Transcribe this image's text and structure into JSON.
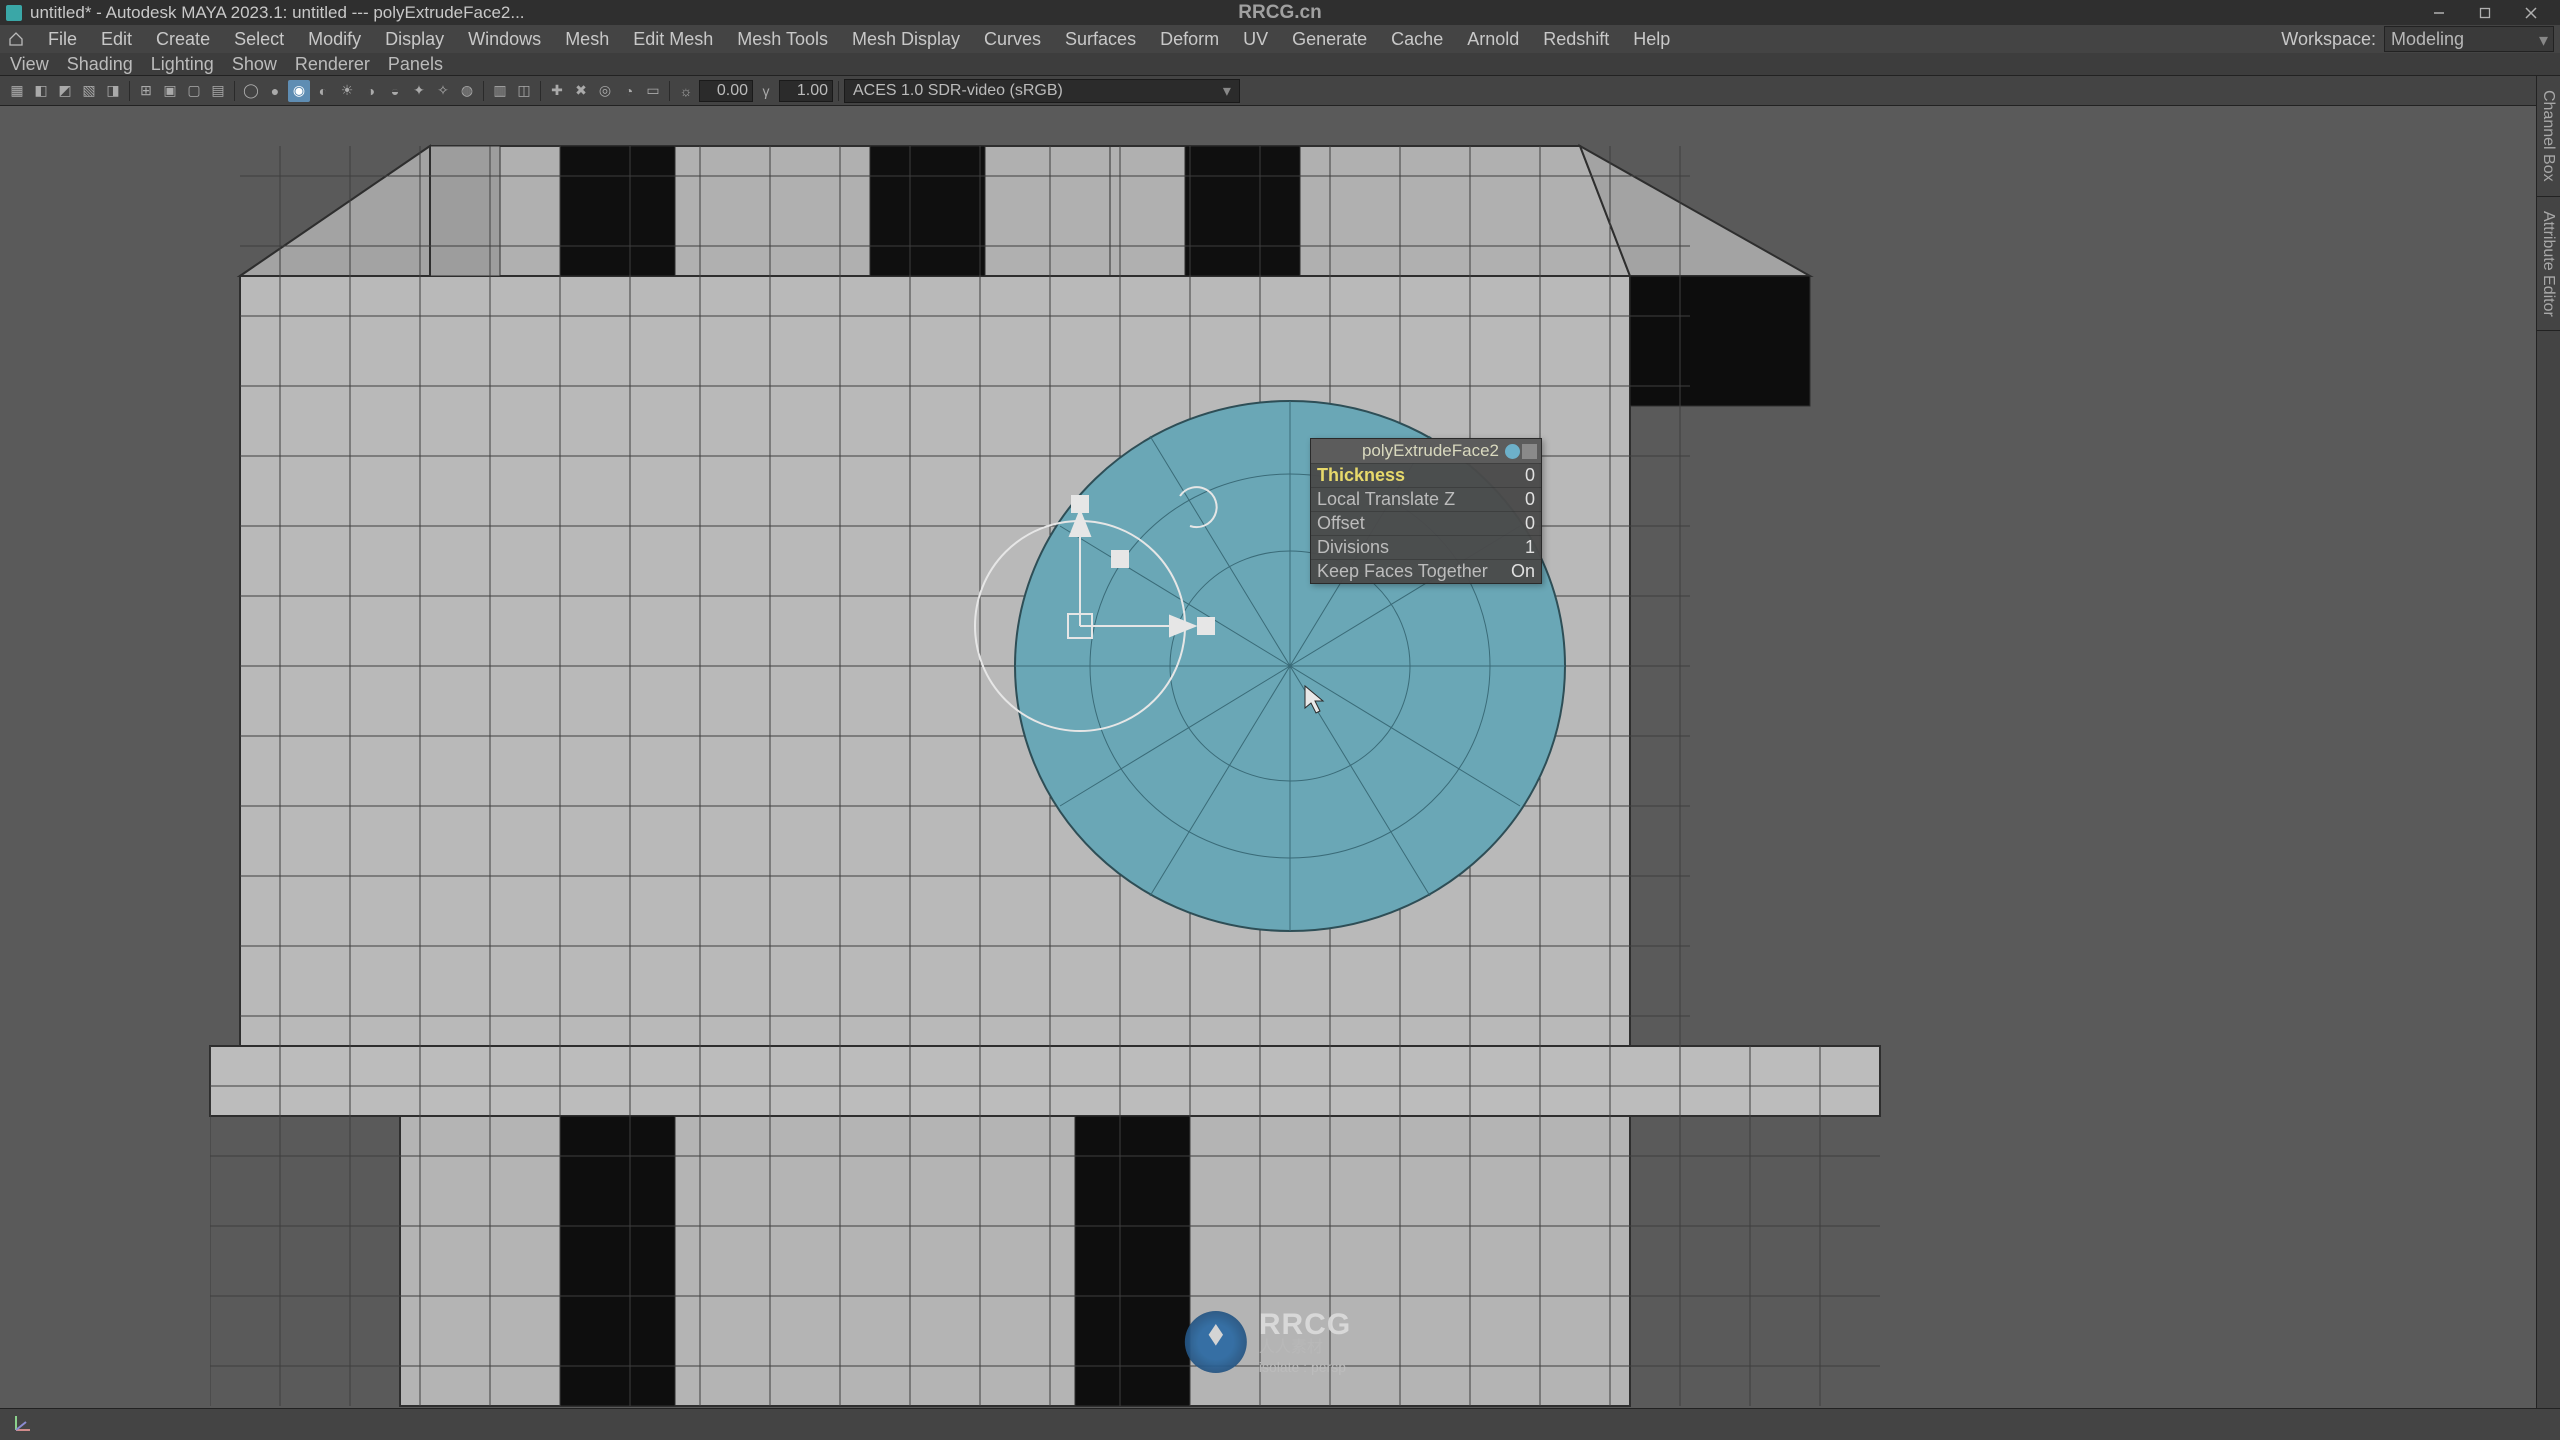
{
  "title": {
    "text": "untitled* - Autodesk MAYA 2023.1: untitled --- polyExtrudeFace2...",
    "center": "RRCG.cn"
  },
  "menus": [
    "File",
    "Edit",
    "Create",
    "Select",
    "Modify",
    "Display",
    "Windows",
    "Mesh",
    "Edit Mesh",
    "Mesh Tools",
    "Mesh Display",
    "Curves",
    "Surfaces",
    "Deform",
    "UV",
    "Generate",
    "Cache",
    "Arnold",
    "Redshift",
    "Help"
  ],
  "workspace": {
    "label": "Workspace:",
    "current": "Modeling"
  },
  "panel_bar": [
    "View",
    "Shading",
    "Lighting",
    "Show",
    "Renderer",
    "Panels"
  ],
  "toolrow": {
    "exp": "0.00",
    "gamma": "1.00",
    "aces": "ACES 1.0 SDR-video (sRGB)"
  },
  "popup": {
    "title": "polyExtrudeFace2",
    "rows": [
      {
        "label": "Thickness",
        "value": "0",
        "hi": true
      },
      {
        "label": "Local Translate Z",
        "value": "0"
      },
      {
        "label": "Offset",
        "value": "0"
      },
      {
        "label": "Divisions",
        "value": "1"
      },
      {
        "label": "Keep Faces Together",
        "value": "On"
      }
    ]
  },
  "docks": [
    "Channel Box",
    "Attribute Editor"
  ],
  "watermark": {
    "big": "RRCG",
    "sub": "人人素材",
    "iso": "isolate : persp"
  },
  "colors": {
    "select": "#6aa7b6"
  },
  "chart_data": null
}
